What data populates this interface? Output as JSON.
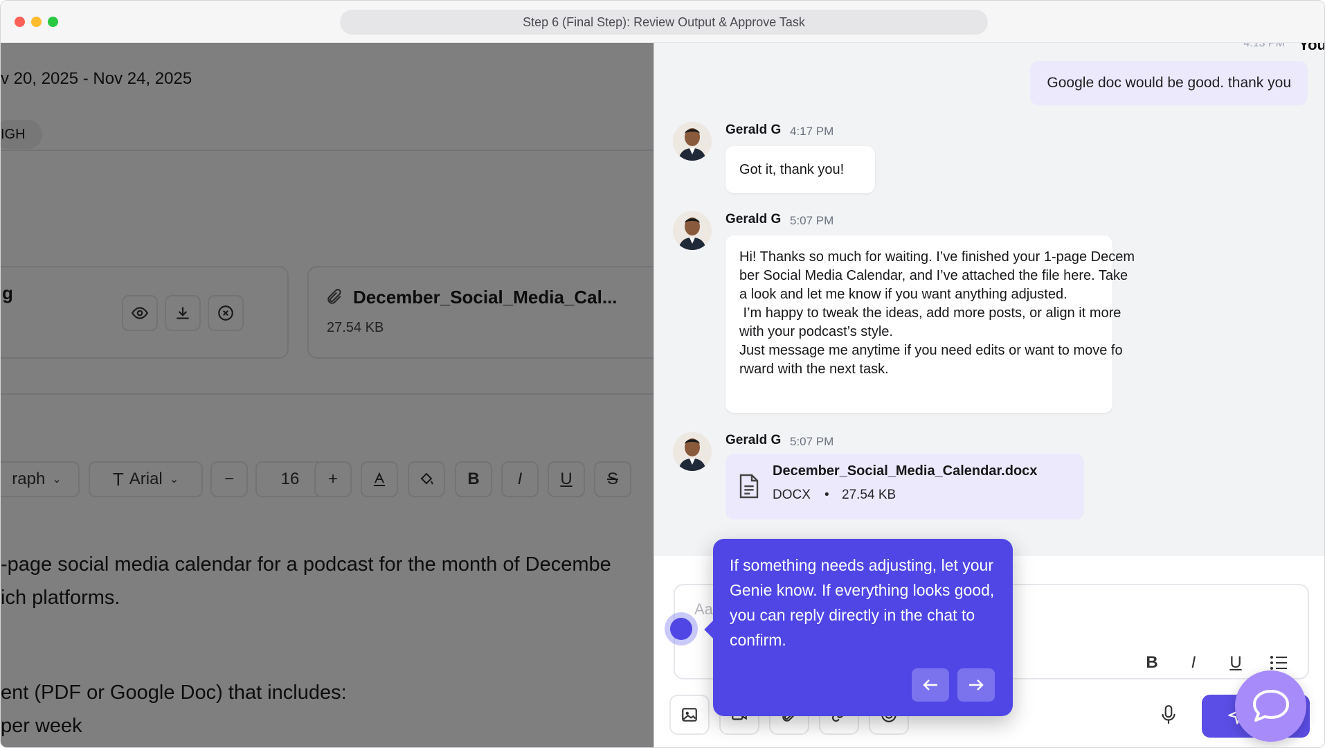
{
  "window": {
    "title": "Step 6 (Final Step): Review Output & Approve Task"
  },
  "task_panel": {
    "date_range": "v 20, 2025 - Nov 24, 2025",
    "priority": "IGH",
    "file_card_1": {
      "name": "g"
    },
    "file_card_2": {
      "name": "December_Social_Media_Cal...",
      "size": "27.54 KB"
    },
    "editor_toolbar": {
      "paragraph_style": "raph",
      "font": "Arial",
      "font_size": "16"
    },
    "doc_lines": [
      "-page social media calendar for a podcast for the month of Decembe",
      "ich platforms.",
      "ent (PDF or Google Doc) that includes:",
      "per week"
    ]
  },
  "chat": {
    "top_time": "4:13 PM",
    "you_label": "You",
    "own_message": "Google doc would be good. thank you",
    "messages": [
      {
        "sender": "Gerald G",
        "time": "4:17 PM",
        "text": "Got it, thank you!"
      },
      {
        "sender": "Gerald G",
        "time": "5:07 PM",
        "lines": [
          "Hi! Thanks so much for waiting. I’ve finished your 1-page Decem",
          "ber Social Media Calendar, and I’ve attached the file here. Take",
          "a look and let me know if you want anything adjusted.",
          "",
          " I’m happy to tweak the ideas, add more posts, or align it more",
          "with your podcast’s style.",
          "Just message me anytime if you need edits or want to move fo",
          "rward with the next task."
        ]
      },
      {
        "sender": "Gerald G",
        "time": "5:07 PM"
      }
    ],
    "attachment": {
      "filename": "December_Social_Media_Calendar.docx",
      "type": "DOCX",
      "separator": "•",
      "size": "27.54 KB"
    },
    "composer": {
      "placeholder": "Aa"
    }
  },
  "tooltip": {
    "text": "If something needs adjusting, let your Genie know. If everything looks good, you can reply directly in the chat to confirm."
  },
  "icons": {
    "eye": "eye-icon",
    "download": "download-icon",
    "remove": "close-circle-icon",
    "paperclip": "paperclip-icon",
    "file": "document-icon",
    "mic": "microphone-icon",
    "send": "send-icon",
    "chat": "chat-bubble-icon"
  },
  "colors": {
    "accent": "#4f46e5",
    "own_bubble": "#ebe9fb",
    "fab": "#a78bfa"
  }
}
